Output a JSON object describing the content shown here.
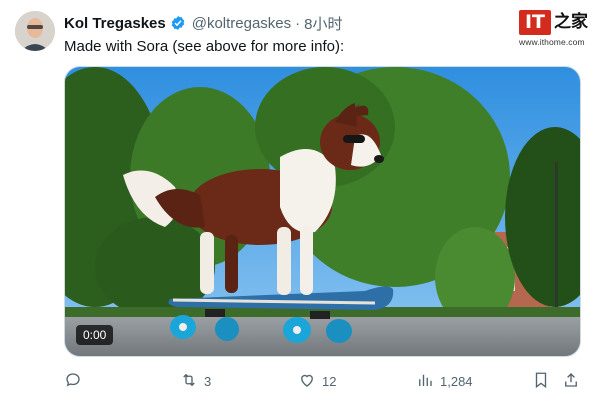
{
  "tweet": {
    "author_name": "Kol Tregaskes",
    "handle": "@koltregaskes",
    "separator": "·",
    "time": "8小时",
    "text": "Made with Sora (see above for more info):"
  },
  "video": {
    "timestamp": "0:00"
  },
  "actions": {
    "reply_count": "",
    "retweet_count": "3",
    "like_count": "12",
    "view_count": "1,284"
  },
  "watermark": {
    "logo_letters": "IT",
    "logo_char": "之家",
    "url": "www.ithome.com"
  },
  "colors": {
    "brand_red": "#d42b1f",
    "verified_blue": "#1d9bf0",
    "secondary_text": "#536471"
  },
  "icons": {
    "verified": "verified-badge-icon",
    "reply": "reply-icon",
    "retweet": "retweet-icon",
    "like": "heart-icon",
    "views": "views-bar-chart-icon",
    "bookmark": "bookmark-icon",
    "share": "share-icon"
  }
}
